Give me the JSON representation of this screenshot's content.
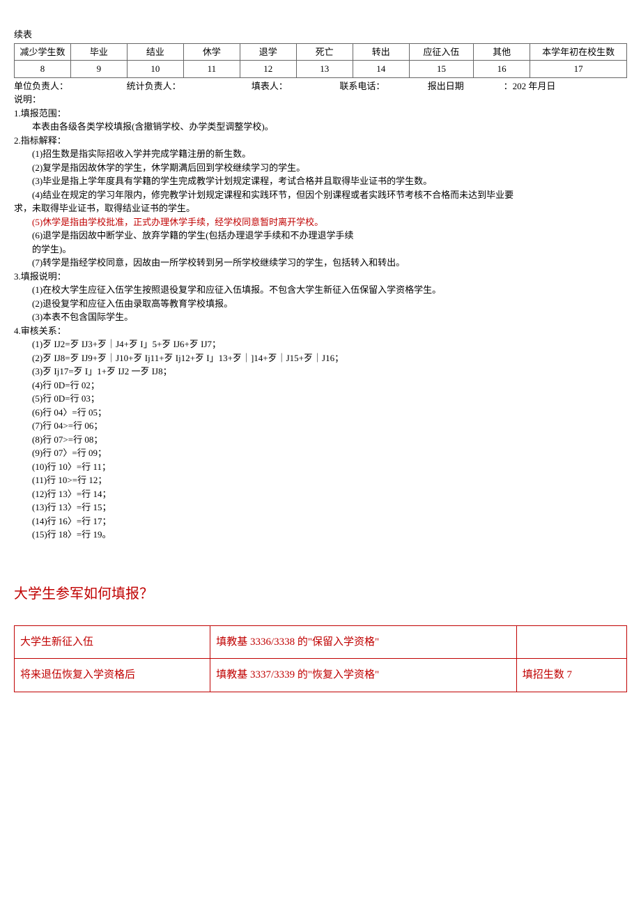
{
  "continued_label": "续表",
  "table_header": {
    "group_left": "减少学生数",
    "cols": [
      "毕业",
      "结业",
      "休学",
      "退学",
      "死亡",
      "转出",
      "应征入伍",
      "其他"
    ],
    "group_right": "本学年初在校生数",
    "nums": [
      "8",
      "9",
      "10",
      "11",
      "12",
      "13",
      "14",
      "15",
      "16",
      "17"
    ]
  },
  "footer": {
    "a": "单位负责人：",
    "b": "统计负责人：",
    "c": "填表人：",
    "d": "联系电话：",
    "e": "报出日期",
    "f": "：202 年月日"
  },
  "shuoming": "说明：",
  "sec1_title": "1.填报范围：",
  "sec1_body": "本表由各级各类学校填报(含撤销学校、办学类型调整学校)。",
  "sec2_title": "2.指标解释：",
  "sec2_items": [
    "(1)招生数是指实际招收入学并完成学籍注册的新生数。",
    "(2)复学是指因故休学的学生，休学期满后回到学校继续学习的学生。",
    "(3)毕业是指上学年度具有学籍的学生完成教学计划规定课程，考试合格并且取得毕业证书的学生数。"
  ],
  "sec2_item4_a": "(4)结业在规定的学习年限内，修完教学计划规定课程和实践环节，但因个别课程或者实践环节考核不合格而未达到毕业要",
  "sec2_item4_b": "求，未取得毕业证书，取得结业证书的学生。",
  "sec2_item5": "(5)休学是指由学校批准，正式办理休学手续，经学校同意暂时离开学校。",
  "sec2_item6_a": "(6)退学是指因故中断学业、放弃学籍的学生(包括办理退学手续和不办理退学手续",
  "sec2_item6_b": "的学生)。",
  "sec2_item7": "(7)转学是指经学校同意，因故由一所学校转到另一所学校继续学习的学生，包括转入和转出。",
  "sec3_title": "3.填报说明：",
  "sec3_items": [
    "(1)在校大学生应征入伍学生按照退役复学和应征入伍填报。不包含大学生新征入伍保留入学资格学生。",
    "(2)退役复学和应征入伍由录取高等教育学校填报。",
    "(3)本表不包含国际学生。"
  ],
  "sec4_title": "4.审核关系：",
  "sec4_items": [
    "(1)歹 IJ2=歹 IJ3+歹｜J4+歹 I」5+歹 IJ6+歹 IJ7；",
    "(2)歹 IJ8=歹 IJ9+歹｜J10+歹 Ij11+歹 Ij12+歹 I」13+歹｜]14+歹｜J15+歹｜J16；",
    "(3)歹 Ij17=歹 I」1+歹 IJ2 一歹 IJ8；",
    "(4)行 0D=行 02；",
    "(5)行 0D=行 03；",
    "(6)行 04〉=行 05；",
    "(7)行 04>=行 06；",
    "(8)行 07>=行 08；",
    "(9)行 07〉=行 09；",
    "(10)行 10〉=行 11；",
    "(11)行 10>=行 12；",
    "(12)行 13〉=行 14；",
    "(13)行 13〉=行 15；",
    "(14)行 16〉=行 17；",
    "(15)行 18〉=行 19。"
  ],
  "question": "大学生参军如何填报？",
  "answer_table": [
    [
      "大学生新征入伍",
      "填教基 3336/3338 的\"保留入学资格\"",
      ""
    ],
    [
      "将来退伍恢复入学资格后",
      "填教基 3337/3339 的\"恢复入学资格\"",
      "填招生数 7"
    ]
  ]
}
